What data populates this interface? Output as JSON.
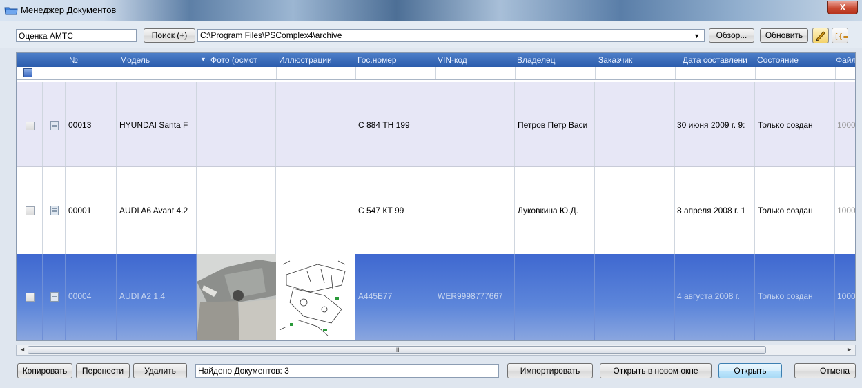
{
  "window": {
    "title": "Менеджер Документов",
    "close_label": "X"
  },
  "toolbar": {
    "doc_type": "Оценка АМТС",
    "search_label": "Поиск (+)",
    "path": "C:\\Program Files\\PSComplex4\\archive",
    "browse_label": "Обзор...",
    "refresh_label": "Обновить",
    "pen_icon": "pencil-icon",
    "columns_icon": "columns-icon"
  },
  "grid": {
    "columns": [
      "№",
      "Модель",
      "Фото (осмот",
      "Иллюстрации",
      "Гос.номер",
      "VIN-код",
      "Владелец",
      "Заказчик",
      "Дата составлени",
      "Состояние",
      "Файл"
    ],
    "sort_indicator": "▼",
    "rows": [
      {
        "no": "00013",
        "model": "HYUNDAI Santa F",
        "plate": "С 884 ТН 199",
        "vin": "",
        "owner": "Петров Петр Васи",
        "customer": "",
        "date": "30 июня 2009 г. 9:",
        "state": "Только создан",
        "file": "1000"
      },
      {
        "no": "00001",
        "model": "AUDI A6 Avant 4.2",
        "plate": "С 547 КТ 99",
        "vin": "",
        "owner": "Луковкина Ю.Д.",
        "customer": "",
        "date": "8 апреля 2008 г. 1",
        "state": "Только создан",
        "file": "1000"
      },
      {
        "no": "00004",
        "model": "AUDI A2 1.4",
        "plate": "А445Б77",
        "vin": "WER9998777667",
        "owner": "",
        "customer": "",
        "date": "4 августа 2008 г.",
        "state": "Только создан",
        "file": "1000"
      }
    ],
    "scroll_thumb": "III"
  },
  "bottom": {
    "copy_label": "Копировать",
    "move_label": "Перенести",
    "delete_label": "Удалить",
    "status": "Найдено Документов: 3",
    "import_label": "Импортировать",
    "open_new_label": "Открыть в новом окне",
    "open_label": "Открыть",
    "cancel_label": "Отмена"
  }
}
